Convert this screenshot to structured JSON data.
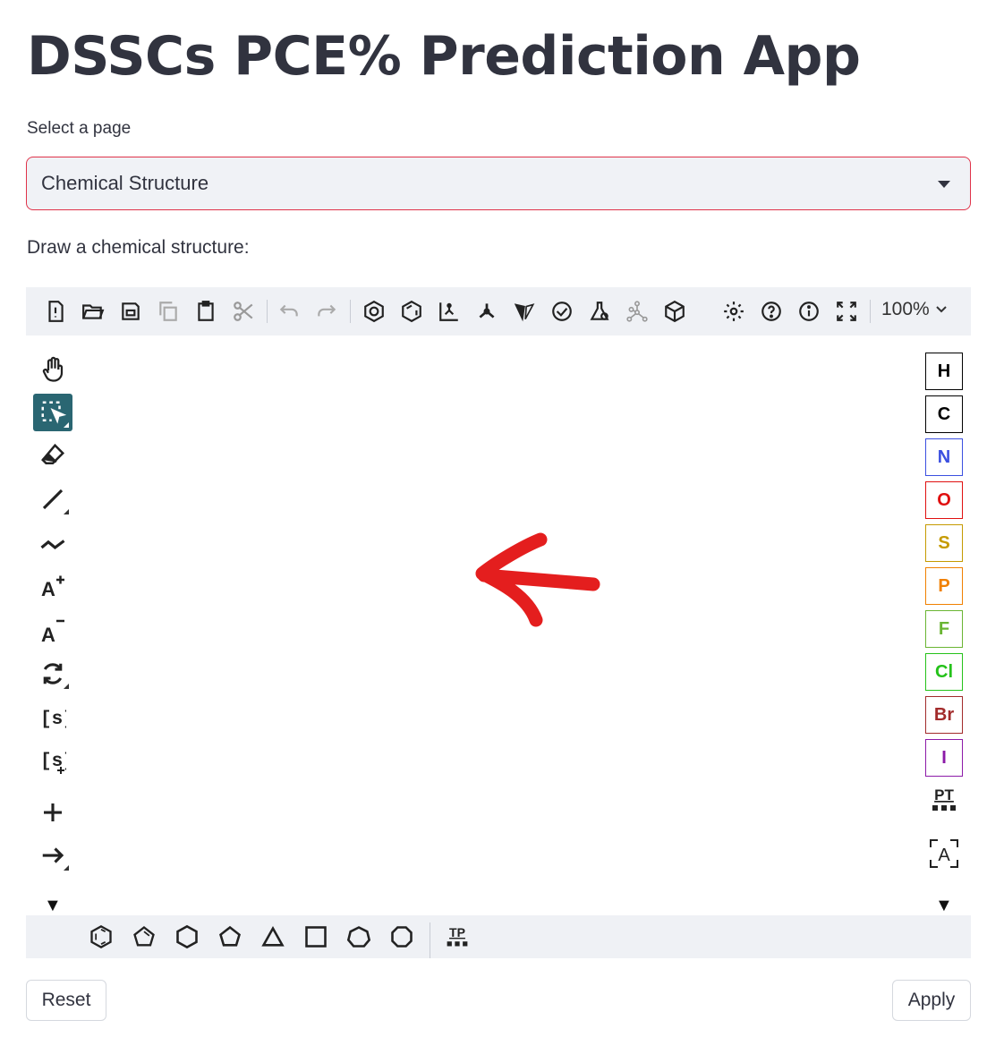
{
  "app": {
    "title": "DSSCs PCE% Prediction App"
  },
  "page_select": {
    "label": "Select a page",
    "value": "Chemical Structure"
  },
  "editor": {
    "label": "Draw a chemical structure:",
    "zoom": "100%",
    "elements": [
      {
        "symbol": "H",
        "color": "#000000"
      },
      {
        "symbol": "C",
        "color": "#000000"
      },
      {
        "symbol": "N",
        "color": "#3b4fe0"
      },
      {
        "symbol": "O",
        "color": "#e01010"
      },
      {
        "symbol": "S",
        "color": "#c59a00"
      },
      {
        "symbol": "P",
        "color": "#f08000"
      },
      {
        "symbol": "F",
        "color": "#6ab533"
      },
      {
        "symbol": "Cl",
        "color": "#25c21a"
      },
      {
        "symbol": "Br",
        "color": "#a22b2b"
      },
      {
        "symbol": "I",
        "color": "#8c1aa8"
      }
    ],
    "periodic_table_label": "PT",
    "template_label": "TP",
    "expand_glyph": "▼",
    "sgroup_label": "[s]",
    "annotation_color": "#e41e1e"
  },
  "buttons": {
    "reset": "Reset",
    "apply": "Apply"
  }
}
